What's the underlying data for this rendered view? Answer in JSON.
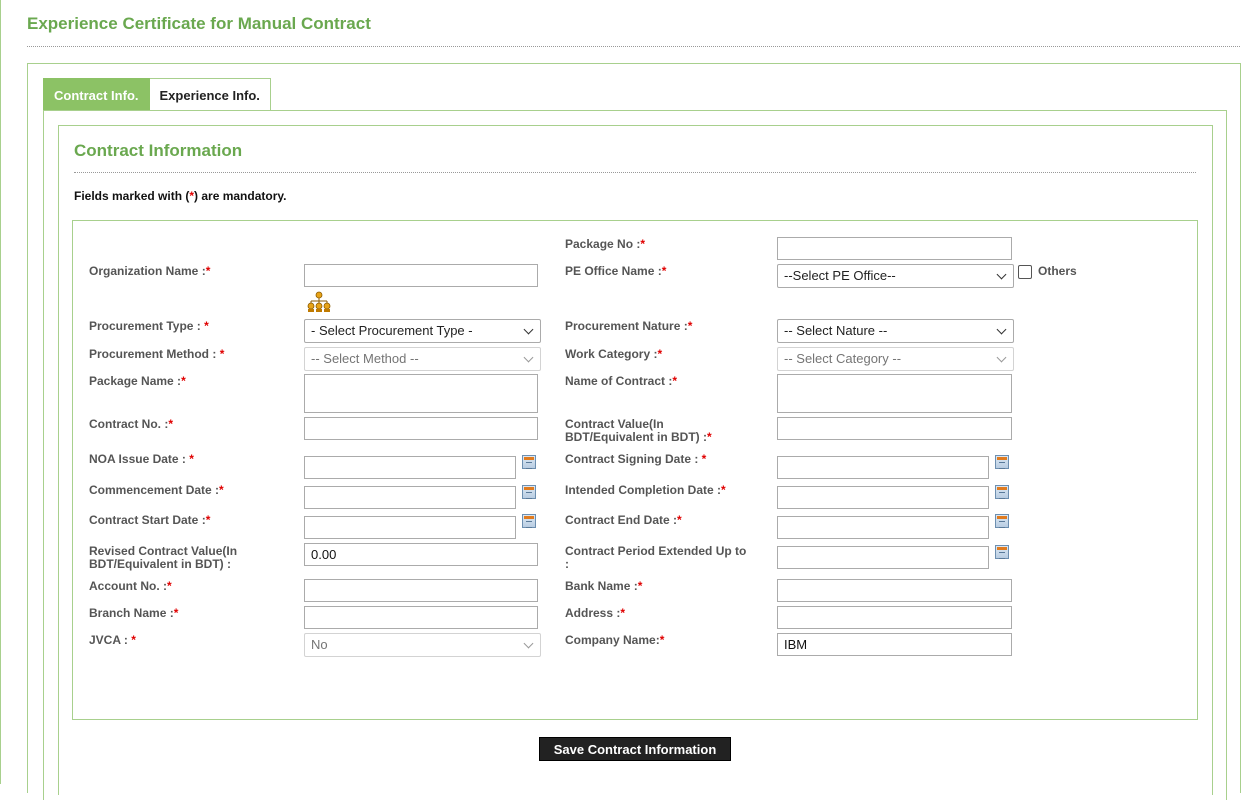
{
  "page": {
    "title": "Experience Certificate for Manual Contract"
  },
  "tabs": [
    {
      "label": "Contract Info.",
      "active": true
    },
    {
      "label": "Experience Info.",
      "active": false
    }
  ],
  "section": {
    "title": "Contract Information",
    "mandatory_prefix": "Fields marked with (",
    "mandatory_star": "*",
    "mandatory_suffix": ") are mandatory."
  },
  "form": {
    "package_no": {
      "label": "Package No :",
      "value": ""
    },
    "organization_name": {
      "label": "Organization Name :",
      "value": ""
    },
    "pe_office_name": {
      "label": "PE Office Name :",
      "selected": "--Select PE Office--"
    },
    "others": {
      "label": "Others",
      "checked": false
    },
    "procurement_type": {
      "label": "Procurement Type : ",
      "selected": "- Select Procurement Type -"
    },
    "procurement_nature": {
      "label": "Procurement Nature :",
      "selected": "-- Select Nature --"
    },
    "procurement_method": {
      "label": "Procurement Method : ",
      "selected": "-- Select Method --"
    },
    "work_category": {
      "label": "Work Category :",
      "selected": "-- Select Category --"
    },
    "package_name": {
      "label": "Package Name :",
      "value": ""
    },
    "name_of_contract": {
      "label": "Name of Contract :",
      "value": ""
    },
    "contract_no": {
      "label": "Contract No. :",
      "value": ""
    },
    "contract_value": {
      "label_line1": "Contract Value(In",
      "label_line2": "BDT/Equivalent in BDT) :",
      "value": ""
    },
    "noa_issue_date": {
      "label": "NOA Issue Date : ",
      "value": ""
    },
    "contract_signing_date": {
      "label": "Contract Signing Date : ",
      "value": ""
    },
    "commencement_date": {
      "label": "Commencement Date :",
      "value": ""
    },
    "intended_completion_date": {
      "label": "Intended Completion Date :",
      "value": ""
    },
    "contract_start_date": {
      "label": "Contract Start Date :",
      "value": ""
    },
    "contract_end_date": {
      "label": "Contract End Date :",
      "value": ""
    },
    "revised_contract_value": {
      "label_line1": "Revised Contract Value(In",
      "label_line2": "BDT/Equivalent in BDT) :",
      "value": "0.00"
    },
    "contract_period_extended": {
      "label_line1": "Contract Period Extended Up to",
      "label_line2": ":",
      "value": ""
    },
    "account_no": {
      "label": "Account No. :",
      "value": ""
    },
    "bank_name": {
      "label": "Bank Name :",
      "value": ""
    },
    "branch_name": {
      "label": "Branch Name :",
      "value": ""
    },
    "address": {
      "label": "Address :",
      "value": ""
    },
    "jvca": {
      "label": "JVCA : ",
      "selected": "No"
    },
    "company_name": {
      "label": "Company Name:",
      "value": "IBM"
    }
  },
  "actions": {
    "save_label": "Save Contract Information"
  },
  "icons": {
    "calendar": "calendar-icon",
    "organization": "org-chart-icon",
    "dropdown": "chevron-down-icon"
  },
  "colors": {
    "accent_green": "#6aa84f",
    "tab_active": "#8cc265",
    "border_green": "#a8d08d",
    "required_red": "#e00000",
    "button_dark": "#222222"
  }
}
